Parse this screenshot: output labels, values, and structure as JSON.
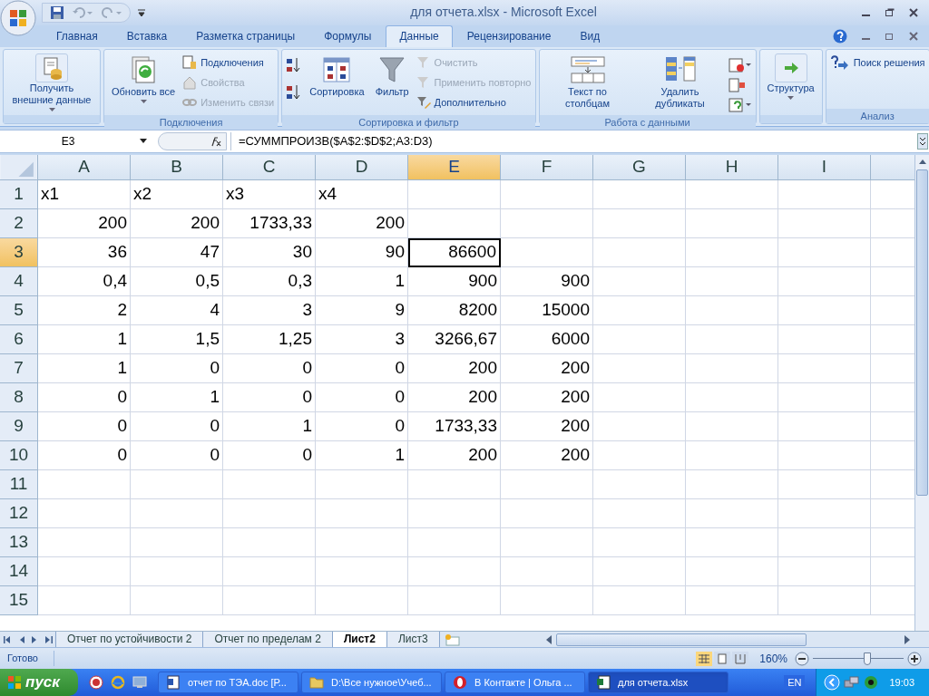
{
  "window": {
    "title": "для отчета.xlsx - Microsoft Excel"
  },
  "ribbon_tabs": [
    {
      "label": "Главная",
      "selected": false
    },
    {
      "label": "Вставка",
      "selected": false
    },
    {
      "label": "Разметка страницы",
      "selected": false
    },
    {
      "label": "Формулы",
      "selected": false
    },
    {
      "label": "Данные",
      "selected": true
    },
    {
      "label": "Рецензирование",
      "selected": false
    },
    {
      "label": "Вид",
      "selected": false
    }
  ],
  "ribbon_groups": [
    {
      "items": [
        {
          "kind": "big",
          "label": "Получить внешние данные",
          "dropdown": true
        }
      ]
    },
    {
      "label": "Подключения",
      "items": [
        {
          "kind": "big",
          "label": "Обновить все",
          "dropdown": true
        },
        {
          "kind": "small",
          "label": "Подключения",
          "disabled": false
        },
        {
          "kind": "small",
          "label": "Свойства",
          "disabled": true
        },
        {
          "kind": "small",
          "label": "Изменить связи",
          "disabled": true
        }
      ]
    },
    {
      "label": "Сортировка и фильтр",
      "items": [
        {
          "kind": "sorticons"
        },
        {
          "kind": "big",
          "label": "Сортировка",
          "dropdown": false
        },
        {
          "kind": "big",
          "label": "Фильтр",
          "dropdown": false
        },
        {
          "kind": "small",
          "label": "Очистить",
          "disabled": true
        },
        {
          "kind": "small",
          "label": "Применить повторно",
          "disabled": true
        },
        {
          "kind": "small",
          "label": "Дополнительно",
          "disabled": false
        }
      ]
    },
    {
      "label": "Работа с данными",
      "items": [
        {
          "kind": "big",
          "label": "Текст по столбцам",
          "dropdown": false
        },
        {
          "kind": "big",
          "label": "Удалить дубликаты",
          "dropdown": false
        },
        {
          "kind": "iconstack"
        }
      ]
    },
    {
      "items": [
        {
          "kind": "big",
          "label": "Структура",
          "dropdown": true
        }
      ]
    },
    {
      "label": "Анализ",
      "items": [
        {
          "kind": "small",
          "label": "Поиск решения",
          "disabled": false
        }
      ]
    }
  ],
  "formula_bar": {
    "name_box": "E3",
    "formula": "=СУММПРОИЗВ($A$2:$D$2;A3:D3)"
  },
  "columns": [
    {
      "label": "A",
      "selected": false
    },
    {
      "label": "B",
      "selected": false
    },
    {
      "label": "C",
      "selected": false
    },
    {
      "label": "D",
      "selected": false
    },
    {
      "label": "E",
      "selected": true
    },
    {
      "label": "F",
      "selected": false
    },
    {
      "label": "G",
      "selected": false
    },
    {
      "label": "H",
      "selected": false
    },
    {
      "label": "I",
      "selected": false
    }
  ],
  "rows": [
    {
      "number": "1",
      "selected": false,
      "kind": "labels",
      "cells": {
        "a": "x1",
        "b": "x2",
        "c": "x3",
        "d": "x4"
      }
    },
    {
      "number": "2",
      "selected": false,
      "kind": "numbers",
      "cells": {
        "a": "200",
        "b": "200",
        "c": "1733,33",
        "d": "200"
      }
    },
    {
      "number": "3",
      "selected": true,
      "kind": "numbers",
      "cells": {
        "a": "36",
        "b": "47",
        "c": "30",
        "d": "90",
        "e": "86600"
      }
    },
    {
      "number": "4",
      "selected": false,
      "kind": "numbers",
      "cells": {
        "a": "0,4",
        "b": "0,5",
        "c": "0,3",
        "d": "1",
        "e": "900",
        "f": "900"
      }
    },
    {
      "number": "5",
      "selected": false,
      "kind": "numbers",
      "cells": {
        "a": "2",
        "b": "4",
        "c": "3",
        "d": "9",
        "e": "8200",
        "f": "15000"
      }
    },
    {
      "number": "6",
      "selected": false,
      "kind": "numbers",
      "cells": {
        "a": "1",
        "b": "1,5",
        "c": "1,25",
        "d": "3",
        "e": "3266,67",
        "f": "6000"
      }
    },
    {
      "number": "7",
      "selected": false,
      "kind": "numbers",
      "cells": {
        "a": "1",
        "b": "0",
        "c": "0",
        "d": "0",
        "e": "200",
        "f": "200"
      }
    },
    {
      "number": "8",
      "selected": false,
      "kind": "numbers",
      "cells": {
        "a": "0",
        "b": "1",
        "c": "0",
        "d": "0",
        "e": "200",
        "f": "200"
      }
    },
    {
      "number": "9",
      "selected": false,
      "kind": "numbers",
      "cells": {
        "a": "0",
        "b": "0",
        "c": "1",
        "d": "0",
        "e": "1733,33",
        "f": "200"
      }
    },
    {
      "number": "10",
      "selected": false,
      "kind": "numbers",
      "cells": {
        "a": "0",
        "b": "0",
        "c": "0",
        "d": "1",
        "e": "200",
        "f": "200"
      }
    },
    {
      "number": "11",
      "selected": false,
      "kind": "numbers",
      "cells": {}
    },
    {
      "number": "12",
      "selected": false,
      "kind": "numbers",
      "cells": {}
    },
    {
      "number": "13",
      "selected": false,
      "kind": "numbers",
      "cells": {}
    },
    {
      "number": "14",
      "selected": false,
      "kind": "numbers",
      "cells": {}
    },
    {
      "number": "15",
      "selected": false,
      "kind": "numbers",
      "cells": {}
    }
  ],
  "sheet_tabs": [
    {
      "label": "Отчет по устойчивости 2",
      "selected": false
    },
    {
      "label": "Отчет по пределам 2",
      "selected": false
    },
    {
      "label": "Лист2",
      "selected": true
    },
    {
      "label": "Лист3",
      "selected": false
    }
  ],
  "status_bar": {
    "status": "Готово",
    "zoom": "160%",
    "zoom_slider": {
      "level": 0.6
    }
  },
  "taskbar": {
    "start": "пуск",
    "tasks": [
      {
        "label": "отчет по ТЭА.doc [Р...",
        "kind": "word",
        "selected": false
      },
      {
        "label": "D:\\Все нужное\\Учеб...",
        "kind": "folder",
        "selected": false
      },
      {
        "label": "В Контакте | Ольга ...",
        "kind": "opera",
        "selected": false
      },
      {
        "label": "для отчета.xlsx",
        "kind": "excel",
        "selected": true
      }
    ],
    "language": "EN",
    "clock": "19:03"
  }
}
